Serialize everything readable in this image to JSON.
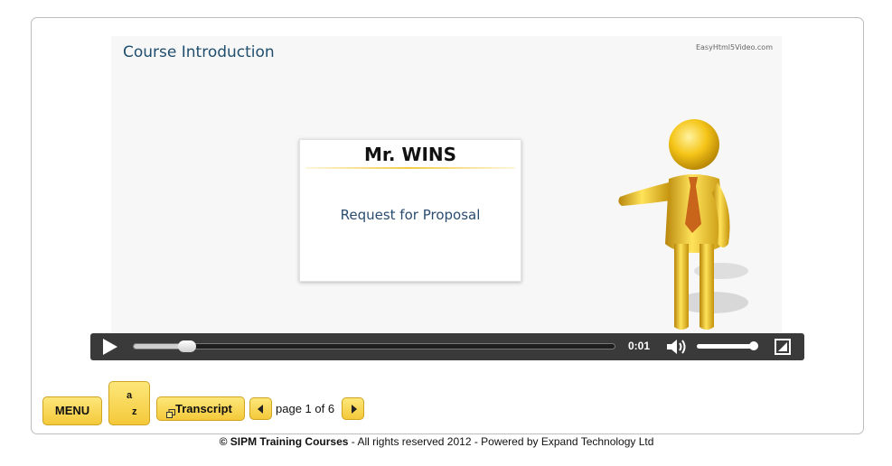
{
  "slide": {
    "title": "Course Introduction",
    "watermark": "EasyHtml5Video.com",
    "card_title": "Mr. WINS",
    "card_subtitle": "Request for Proposal"
  },
  "player": {
    "time": "0:01",
    "progress_fraction": 0.11,
    "volume_fraction": 0.95,
    "icons": [
      "play-icon",
      "volume-icon",
      "fullscreen-icon"
    ]
  },
  "nav": {
    "menu_label": "MENU",
    "glossary_a": "a",
    "glossary_z": "z",
    "transcript_label": "Transcript",
    "page_label": "page 1 of 6"
  },
  "footer": {
    "copyright": "© SIPM Training Courses",
    "rest": " - All rights reserved 2012 - Powered by Expand Technology Ltd"
  },
  "colors": {
    "button_yellow": "#f4c93a",
    "control_bar": "#3a3a3a",
    "title_blue": "#1f4e6e"
  }
}
